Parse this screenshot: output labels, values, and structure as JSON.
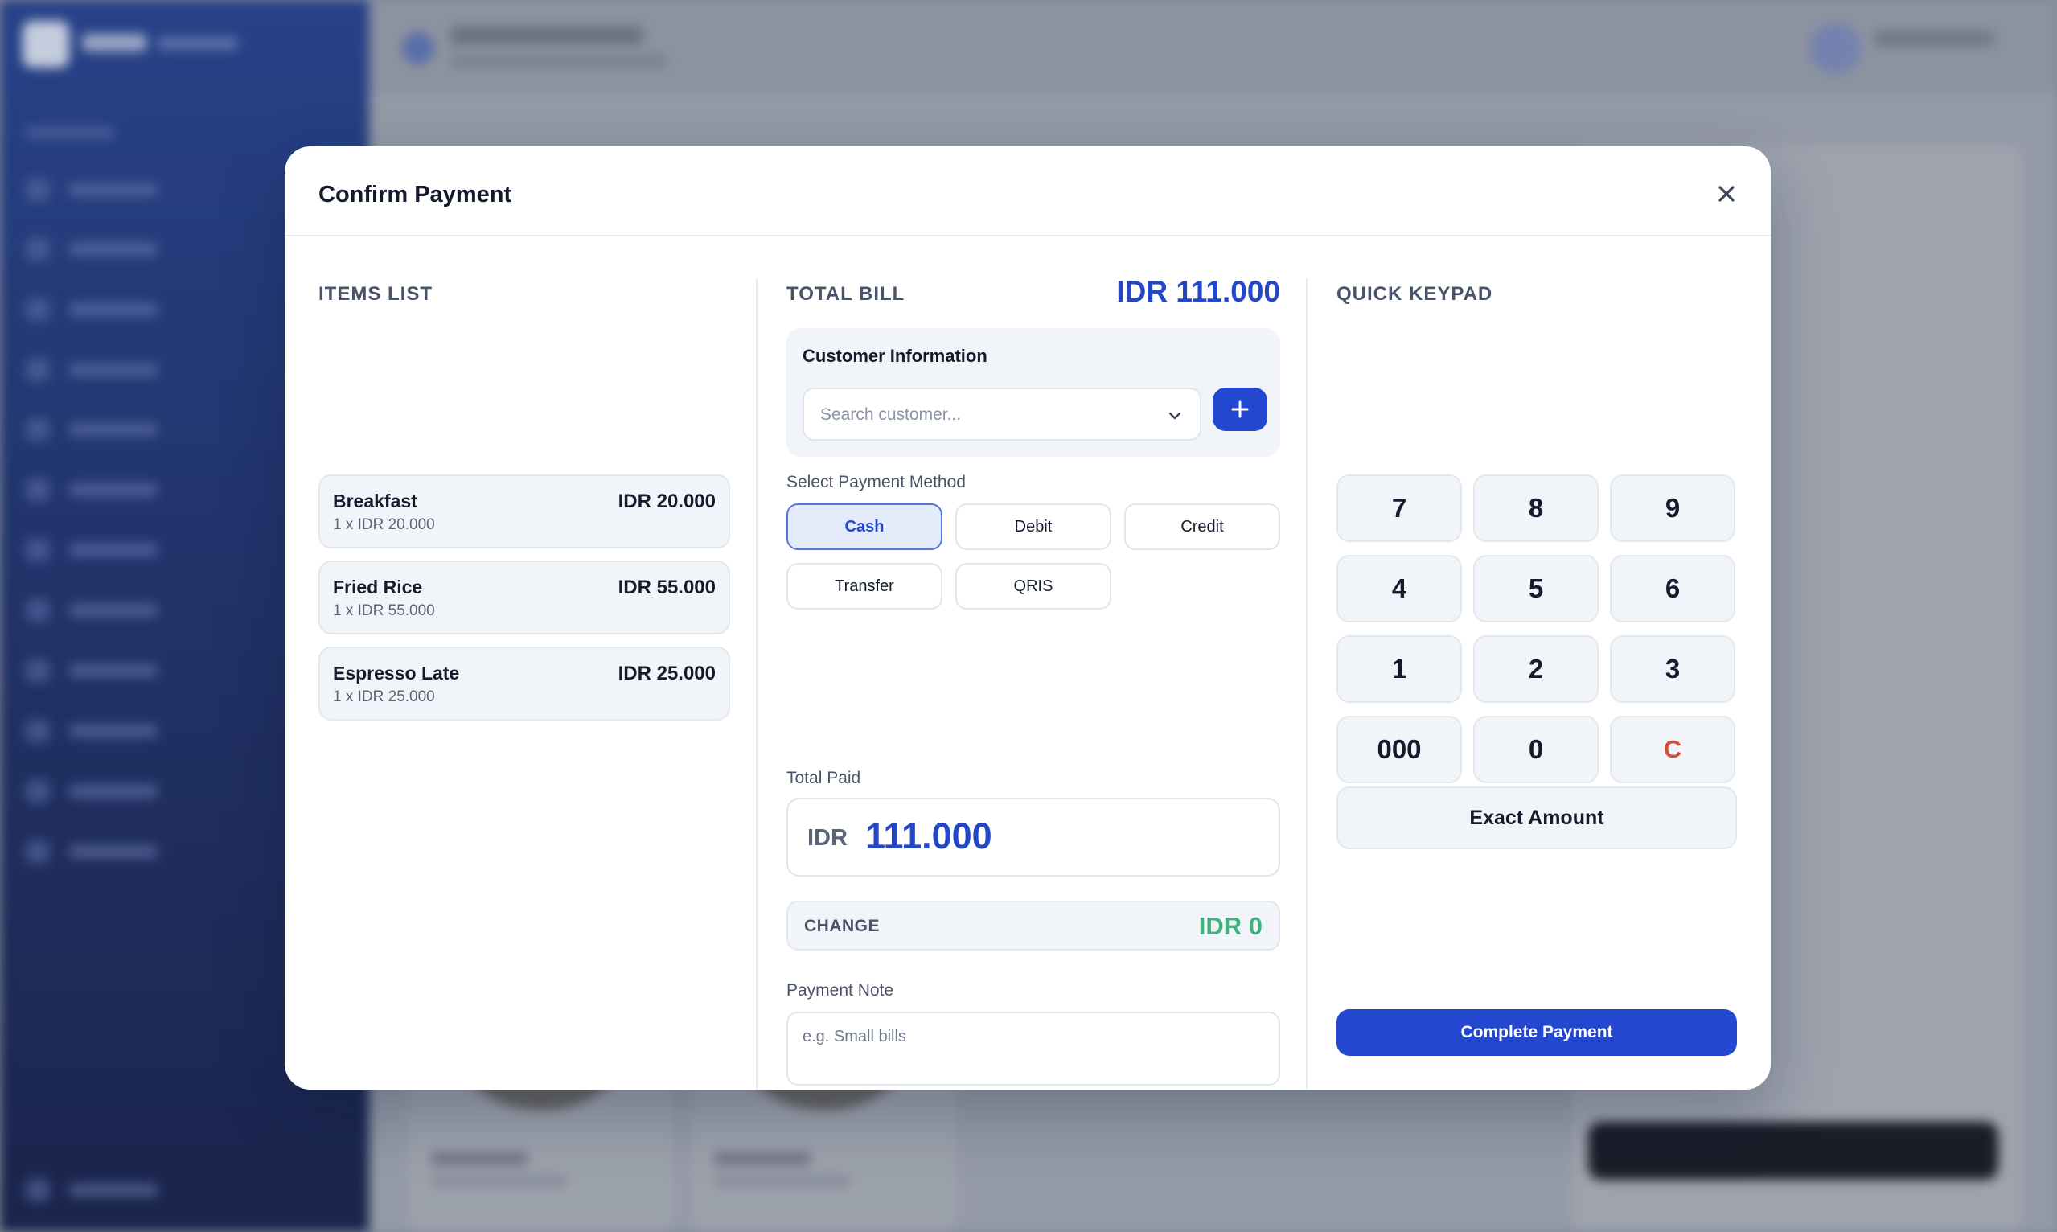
{
  "modal": {
    "title": "Confirm Payment",
    "close_icon": "close-icon"
  },
  "items": {
    "label": "ITEMS LIST",
    "list": [
      {
        "name": "Breakfast",
        "detail": "1 x IDR 20.000",
        "price": "IDR 20.000"
      },
      {
        "name": "Fried Rice",
        "detail": "1 x IDR 55.000",
        "price": "IDR 55.000"
      },
      {
        "name": "Espresso Late",
        "detail": "1 x IDR 25.000",
        "price": "IDR 25.000"
      }
    ]
  },
  "bill": {
    "label": "TOTAL BILL",
    "total": "IDR 111.000"
  },
  "customer": {
    "title": "Customer Information",
    "placeholder": "Search customer...",
    "dropdown_icon": "chevron-down-icon",
    "add_icon": "plus-icon"
  },
  "payment_method": {
    "label": "Select Payment Method",
    "selected": "Cash",
    "options": [
      "Cash",
      "Debit",
      "Credit",
      "Transfer",
      "QRIS"
    ]
  },
  "total_paid": {
    "label": "Total Paid",
    "currency": "IDR",
    "value": "111.000"
  },
  "change": {
    "label": "CHANGE",
    "value": "IDR 0"
  },
  "note": {
    "label": "Payment Note",
    "placeholder": "e.g. Small bills"
  },
  "keypad": {
    "label": "QUICK KEYPAD",
    "keys": [
      "7",
      "8",
      "9",
      "4",
      "5",
      "6",
      "1",
      "2",
      "3",
      "000",
      "0",
      "C"
    ],
    "exact_label": "Exact Amount"
  },
  "actions": {
    "complete_label": "Complete Payment"
  },
  "colors": {
    "accent": "#2348cf",
    "total_text": "#2446c9",
    "change_text": "#3fb27f",
    "clear_key": "#d84b3a",
    "sidebar": "#1f3d8f"
  }
}
